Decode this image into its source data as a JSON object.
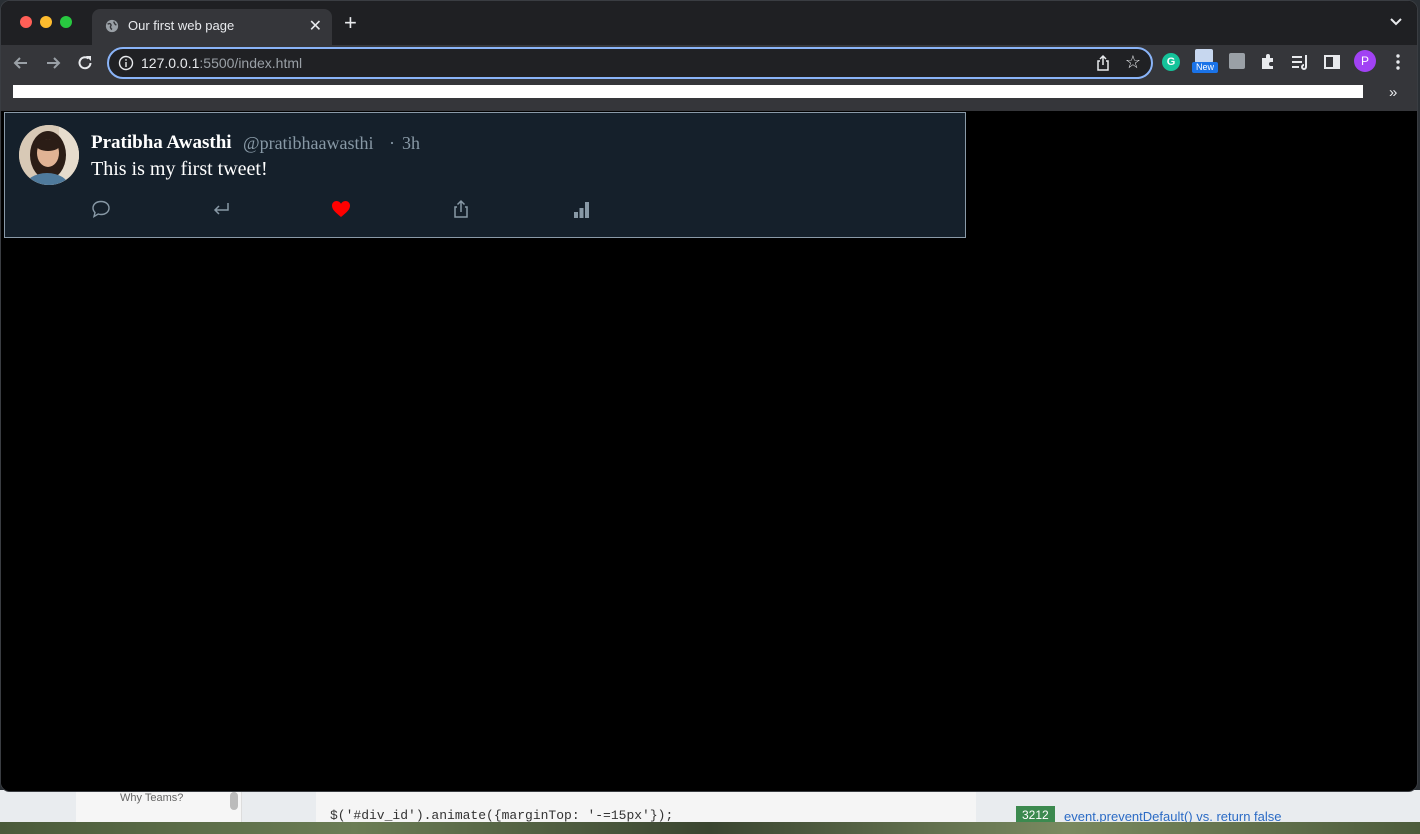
{
  "browser": {
    "tab_title": "Our first web page",
    "new_tab_label": "+",
    "url_host": "127.0.0.1",
    "url_rest": ":5500/index.html",
    "extensions": {
      "grammarly_letter": "G",
      "new_badge": "New",
      "profile_letter": "P"
    },
    "bookmarks_more": "»"
  },
  "tweet": {
    "author_name": "Pratibha Awasthi",
    "handle": "@pratibhaawasthi",
    "separator": "·",
    "time": "3h",
    "text": "This is my first tweet!",
    "liked": true,
    "like_color": "#ff0000",
    "actions": [
      "comment-icon",
      "reply-icon",
      "heart-icon",
      "share-icon",
      "analytics-icon"
    ]
  },
  "background": {
    "sidebar_text": "Why Teams?",
    "code_line": "$('#div_id').animate({marginTop: '-=15px'});",
    "badge": "3212",
    "link": "event.preventDefault() vs. return false"
  },
  "colors": {
    "card_bg": "#15202b",
    "accent": "#8ab4f8",
    "muted": "#8899a6"
  }
}
